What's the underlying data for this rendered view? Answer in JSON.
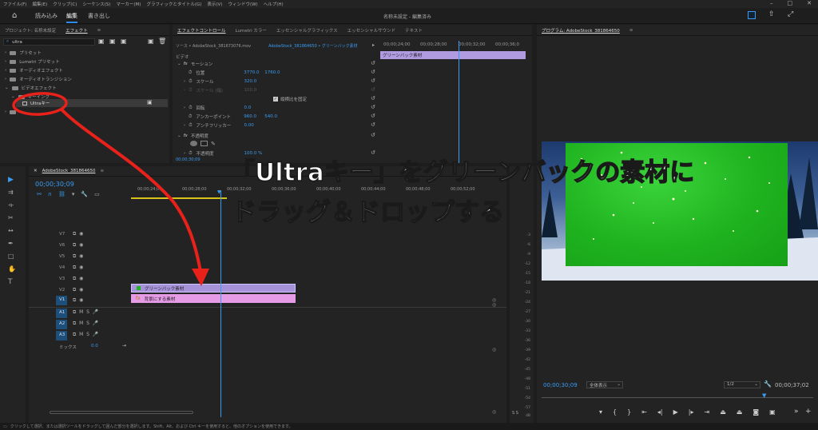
{
  "menu": [
    "ファイル(F)",
    "編集(E)",
    "クリップ(C)",
    "シーケンス(S)",
    "マーカー(M)",
    "グラフィックとタイトル(G)",
    "表示(V)",
    "ウィンドウ(W)",
    "ヘルプ(H)"
  ],
  "workspace": {
    "tabs": [
      "読み込み",
      "編集",
      "書き出し"
    ],
    "active": "編集",
    "title": "名称未設定 - 編集済み"
  },
  "project_panel": {
    "tabs": [
      "プロジェクト: 名称未設定",
      "エフェクト"
    ],
    "search_value": "ultra",
    "tree": [
      "プリセット",
      "Lumetri プリセット",
      "オーディオエフェクト",
      "オーディオトランジション",
      "ビデオエフェクト",
      "キーイング",
      "Ultraキー"
    ]
  },
  "effect_controls": {
    "tabs": [
      "エフェクトコントロール",
      "Lumetri カラー",
      "エッセンシャルグラフィックス",
      "エッセンシャルサウンド",
      "テキスト"
    ],
    "source": "ソース • AdobeStock_381673076.mov",
    "sequence": "AdobeStock_381864650 • グリーンバック素材",
    "times": [
      "00;00;24;00",
      "00;00;28;00",
      "00;00;32;00",
      "00;00;36;0"
    ],
    "clip_label": "グリーンバック素材",
    "video_label": "ビデオ",
    "motion": "モーション",
    "props": [
      {
        "label": "位置",
        "v1": "3770.0",
        "v2": "1760.0"
      },
      {
        "label": "スケール",
        "v1": "320.0",
        "v2": ""
      },
      {
        "label": "スケール (幅)",
        "v1": "100.0",
        "v2": ""
      },
      {
        "label": "",
        "v1": "縦横比を固定",
        "v2": ""
      },
      {
        "label": "回転",
        "v1": "0.0",
        "v2": ""
      },
      {
        "label": "アンカーポイント",
        "v1": "960.0",
        "v2": "540.0"
      },
      {
        "label": "アンチフリッカー",
        "v1": "0.00",
        "v2": ""
      }
    ],
    "opacity_label": "不透明度",
    "opacity_sub": "不透明度",
    "opacity_value": "100.0 %",
    "timecode": "00;00;30;09"
  },
  "program_monitor": {
    "title": "プログラム: AdobeStock_381864650",
    "timecode": "00;00;30;09",
    "fit": "全体表示",
    "quality": "1/2",
    "duration": "00;00;37;02"
  },
  "timeline": {
    "title": "AdobeStock_381864650",
    "timecode": "00;00;30;09",
    "ruler": [
      "00;00;24;00",
      "00;00;28;00",
      "00;00;32;00",
      "00;00;36;00",
      "00;00;40;00",
      "00;00;44;00",
      "00;00;48;00",
      "00;00;52;00"
    ],
    "video_tracks": [
      "V7",
      "V6",
      "V5",
      "V4",
      "V3",
      "V2",
      "V1"
    ],
    "audio_tracks": [
      "A1",
      "A2",
      "A3"
    ],
    "mix_label": "ミックス",
    "mix_value": "0.0",
    "clips": {
      "v2": "グリーンバック素材",
      "v1": "背景にする素材"
    }
  },
  "meter": {
    "scale": [
      "-3",
      "-6",
      "-9",
      "-12",
      "-15",
      "-18",
      "-21",
      "-24",
      "-27",
      "-30",
      "-33",
      "-36",
      "-39",
      "-42",
      "-45",
      "-48",
      "-51",
      "-54",
      "-57",
      "dB"
    ],
    "solo": "S  S"
  },
  "status_bar": "クリックして選択、または選択ツールをドラッグして囲んだ部分を選択します。Shift、Alt、および Ctrl キーを使用すると、他のオプションを使用できます。",
  "overlay": {
    "line1": "「Ultraキー」をグリーンバックの素材に",
    "line2": "ドラッグ＆ドロップする"
  },
  "colors": {
    "accent": "#2d8ceb",
    "annotation": "#e8211b",
    "green_clip": "#a592d8",
    "pink_clip": "#e59be6",
    "green_screen": "#1fb31f"
  }
}
